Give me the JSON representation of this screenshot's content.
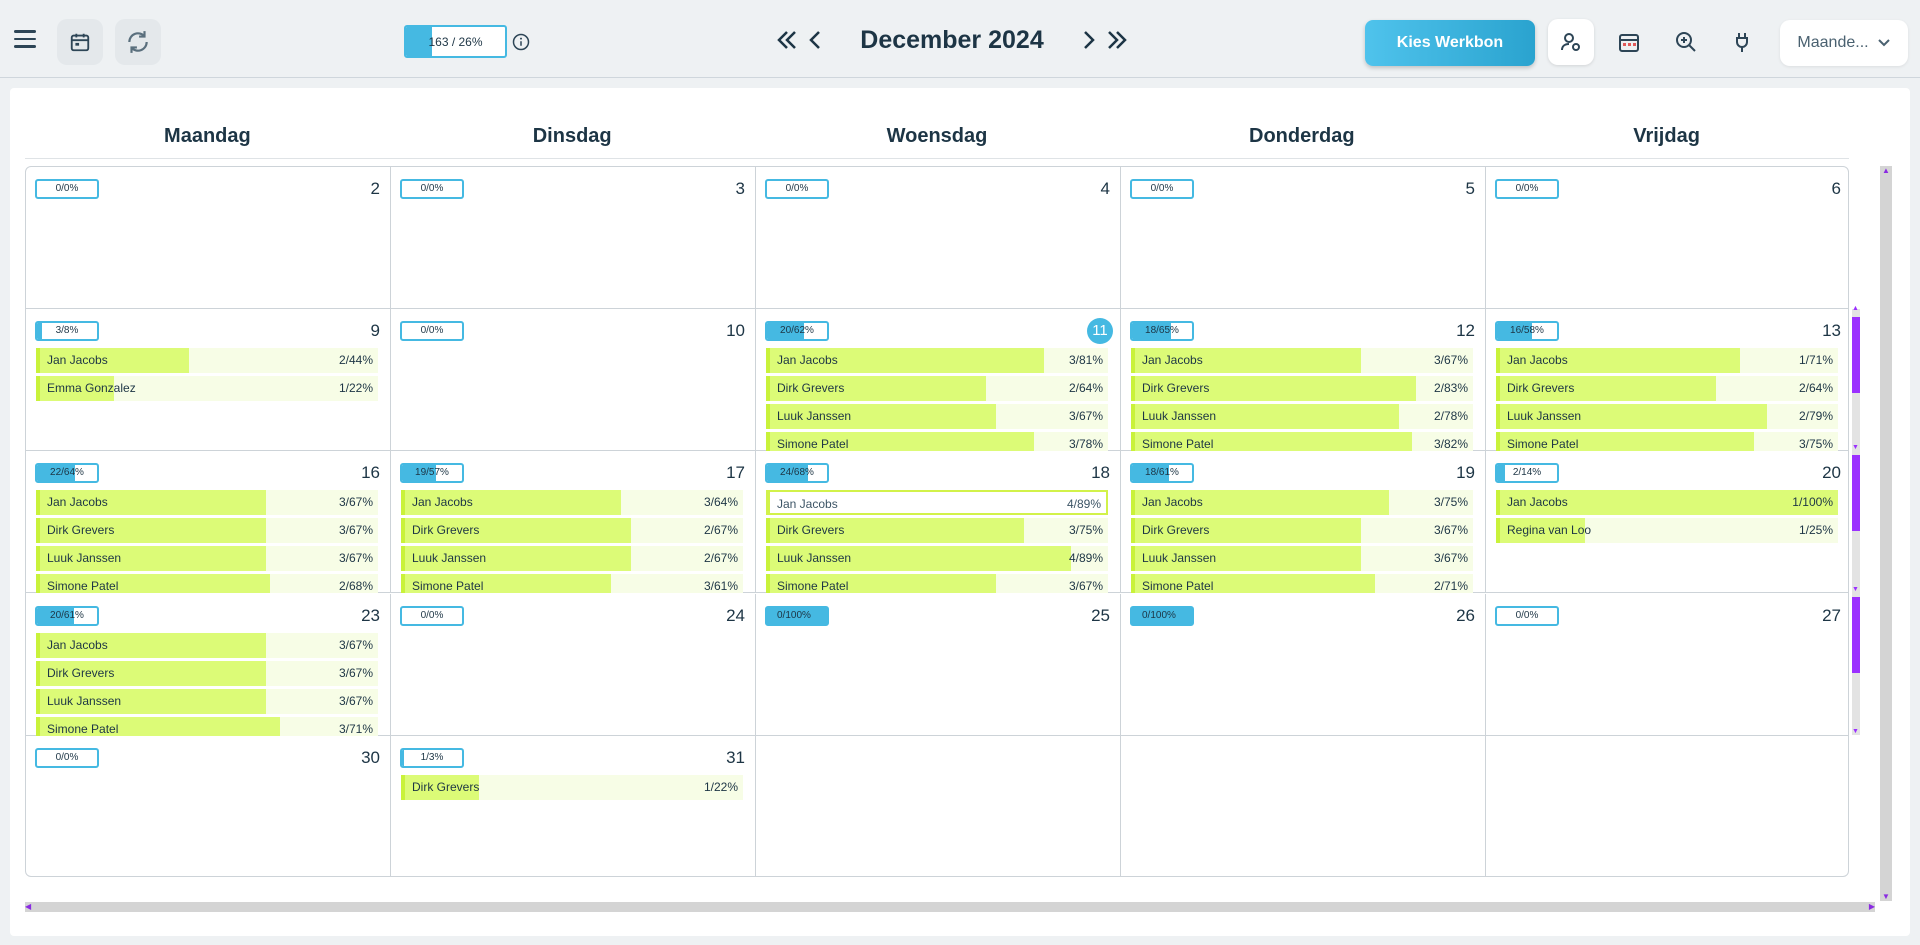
{
  "toolbar": {
    "top_progress": {
      "label": "163 / 26%",
      "fill": 0.26
    },
    "month_title": "December 2024",
    "kies_button": "Kies Werkbon",
    "view_select": "Maande..."
  },
  "day_headers": [
    "Maandag",
    "Dinsdag",
    "Woensdag",
    "Donderdag",
    "Vrijdag"
  ],
  "weeks": [
    {
      "days": [
        {
          "badge": "0/0%",
          "fill": 0,
          "num": "2",
          "emps": []
        },
        {
          "badge": "0/0%",
          "fill": 0,
          "num": "3",
          "emps": []
        },
        {
          "badge": "0/0%",
          "fill": 0,
          "num": "4",
          "emps": []
        },
        {
          "badge": "0/0%",
          "fill": 0,
          "num": "5",
          "emps": []
        },
        {
          "badge": "0/0%",
          "fill": 0,
          "num": "6",
          "emps": []
        }
      ]
    },
    {
      "days": [
        {
          "badge": "3/8%",
          "fill": 0.08,
          "num": "9",
          "emps": [
            {
              "name": "Jan Jacobs",
              "val": "2/44%",
              "fill": 0.44
            },
            {
              "name": "Emma Gonzalez",
              "val": "1/22%",
              "fill": 0.22
            }
          ]
        },
        {
          "badge": "0/0%",
          "fill": 0,
          "num": "10",
          "emps": []
        },
        {
          "badge": "20/62%",
          "fill": 0.62,
          "num": "11",
          "today": true,
          "emps": [
            {
              "name": "Jan Jacobs",
              "val": "3/81%",
              "fill": 0.81
            },
            {
              "name": "Dirk Grevers",
              "val": "2/64%",
              "fill": 0.64
            },
            {
              "name": "Luuk Janssen",
              "val": "3/67%",
              "fill": 0.67
            },
            {
              "name": "Simone Patel",
              "val": "3/78%",
              "fill": 0.78
            }
          ]
        },
        {
          "badge": "18/65%",
          "fill": 0.65,
          "num": "12",
          "emps": [
            {
              "name": "Jan Jacobs",
              "val": "3/67%",
              "fill": 0.67
            },
            {
              "name": "Dirk Grevers",
              "val": "2/83%",
              "fill": 0.83
            },
            {
              "name": "Luuk Janssen",
              "val": "2/78%",
              "fill": 0.78
            },
            {
              "name": "Simone Patel",
              "val": "3/82%",
              "fill": 0.82
            }
          ]
        },
        {
          "badge": "16/58%",
          "fill": 0.58,
          "num": "13",
          "emps": [
            {
              "name": "Jan Jacobs",
              "val": "1/71%",
              "fill": 0.71
            },
            {
              "name": "Dirk Grevers",
              "val": "2/64%",
              "fill": 0.64
            },
            {
              "name": "Luuk Janssen",
              "val": "2/79%",
              "fill": 0.79
            },
            {
              "name": "Simone Patel",
              "val": "3/75%",
              "fill": 0.75
            }
          ]
        }
      ]
    },
    {
      "days": [
        {
          "badge": "22/64%",
          "fill": 0.64,
          "num": "16",
          "emps": [
            {
              "name": "Jan Jacobs",
              "val": "3/67%",
              "fill": 0.67
            },
            {
              "name": "Dirk Grevers",
              "val": "3/67%",
              "fill": 0.67
            },
            {
              "name": "Luuk Janssen",
              "val": "3/67%",
              "fill": 0.67
            },
            {
              "name": "Simone Patel",
              "val": "2/68%",
              "fill": 0.68
            }
          ]
        },
        {
          "badge": "19/57%",
          "fill": 0.57,
          "num": "17",
          "emps": [
            {
              "name": "Jan Jacobs",
              "val": "3/64%",
              "fill": 0.64
            },
            {
              "name": "Dirk Grevers",
              "val": "2/67%",
              "fill": 0.67
            },
            {
              "name": "Luuk Janssen",
              "val": "2/67%",
              "fill": 0.67
            },
            {
              "name": "Simone Patel",
              "val": "3/61%",
              "fill": 0.61
            }
          ]
        },
        {
          "badge": "24/68%",
          "fill": 0.68,
          "num": "18",
          "emps": [
            {
              "name": "Jan Jacobs",
              "val": "4/89%",
              "fill": 0,
              "selected": true
            },
            {
              "name": "Dirk Grevers",
              "val": "3/75%",
              "fill": 0.75
            },
            {
              "name": "Luuk Janssen",
              "val": "4/89%",
              "fill": 0.89
            },
            {
              "name": "Simone Patel",
              "val": "3/67%",
              "fill": 0.67
            }
          ]
        },
        {
          "badge": "18/61%",
          "fill": 0.61,
          "num": "19",
          "emps": [
            {
              "name": "Jan Jacobs",
              "val": "3/75%",
              "fill": 0.75
            },
            {
              "name": "Dirk Grevers",
              "val": "3/67%",
              "fill": 0.67
            },
            {
              "name": "Luuk Janssen",
              "val": "3/67%",
              "fill": 0.67
            },
            {
              "name": "Simone Patel",
              "val": "2/71%",
              "fill": 0.71
            }
          ]
        },
        {
          "badge": "2/14%",
          "fill": 0.14,
          "num": "20",
          "emps": [
            {
              "name": "Jan Jacobs",
              "val": "1/100%",
              "fill": 1.0
            },
            {
              "name": "Regina van Loo",
              "val": "1/25%",
              "fill": 0.25
            }
          ]
        }
      ]
    },
    {
      "days": [
        {
          "badge": "20/61%",
          "fill": 0.61,
          "num": "23",
          "emps": [
            {
              "name": "Jan Jacobs",
              "val": "3/67%",
              "fill": 0.67
            },
            {
              "name": "Dirk Grevers",
              "val": "3/67%",
              "fill": 0.67
            },
            {
              "name": "Luuk Janssen",
              "val": "3/67%",
              "fill": 0.67
            },
            {
              "name": "Simone Patel",
              "val": "3/71%",
              "fill": 0.71
            }
          ]
        },
        {
          "badge": "0/0%",
          "fill": 0,
          "num": "24",
          "emps": []
        },
        {
          "badge": "0/100%",
          "fill": 1.0,
          "num": "25",
          "emps": []
        },
        {
          "badge": "0/100%",
          "fill": 1.0,
          "num": "26",
          "emps": []
        },
        {
          "badge": "0/0%",
          "fill": 0,
          "num": "27",
          "emps": []
        }
      ]
    },
    {
      "days": [
        {
          "badge": "0/0%",
          "fill": 0,
          "num": "30",
          "emps": []
        },
        {
          "badge": "1/3%",
          "fill": 0.03,
          "num": "31",
          "emps": [
            {
              "name": "Dirk Grevers",
              "val": "1/22%",
              "fill": 0.22
            }
          ]
        },
        {
          "badge": "",
          "fill": 0,
          "num": "",
          "empty": true,
          "emps": []
        },
        {
          "badge": "",
          "fill": 0,
          "num": "",
          "empty": true,
          "emps": []
        },
        {
          "badge": "",
          "fill": 0,
          "num": "",
          "empty": true,
          "emps": []
        }
      ]
    }
  ],
  "colors": {
    "accent": "#45b9e2",
    "employee_bar": "#dcfb77",
    "scroll_thumb": "#9b30ff"
  }
}
